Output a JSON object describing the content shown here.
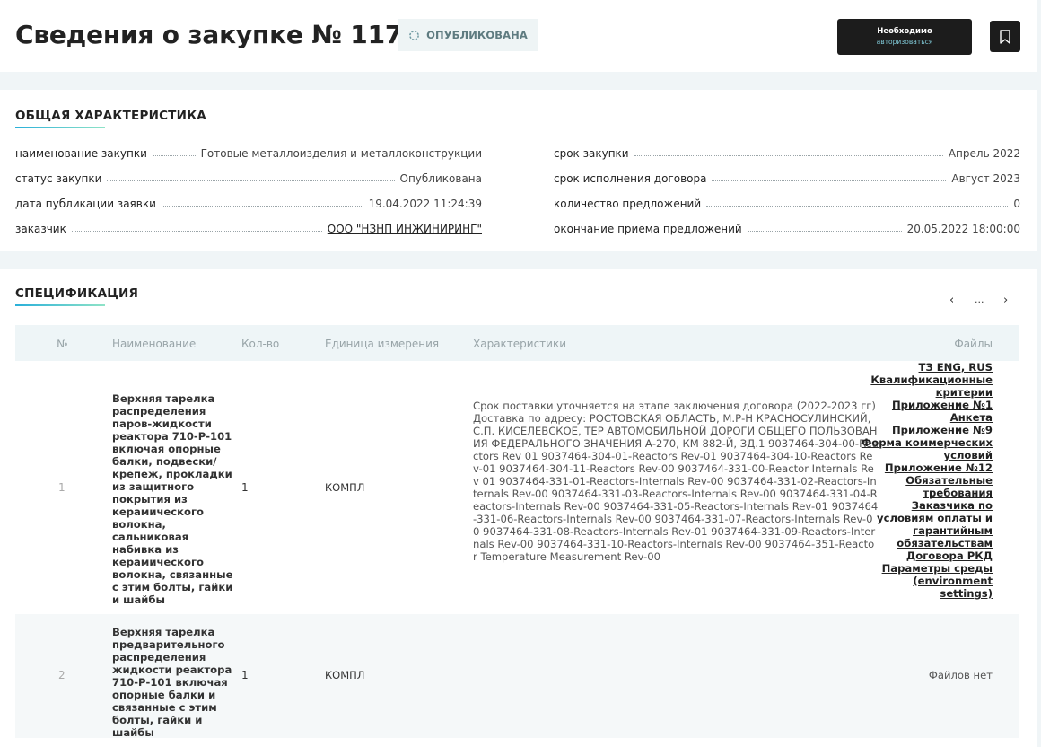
{
  "header": {
    "title": "Сведения о закупке № 11720",
    "status": "ОПУБЛИКОВАНА",
    "auth_line1": "Необходимо",
    "auth_line2": "авторизоваться"
  },
  "general": {
    "title": "ОБЩАЯ ХАРАКТЕРИСТИКА",
    "left": [
      {
        "label": "наименование закупки",
        "value": "Готовые металлоизделия и металлоконструкции"
      },
      {
        "label": "статус закупки",
        "value": "Опубликована"
      },
      {
        "label": "дата публикации заявки",
        "value": "19.04.2022 11:24:39"
      },
      {
        "label": "заказчик",
        "value": "ООО \"НЗНП ИНЖИНИРИНГ\""
      }
    ],
    "right": [
      {
        "label": "срок закупки",
        "value": "Апрель 2022"
      },
      {
        "label": "срок исполнения договора",
        "value": "Август 2023"
      },
      {
        "label": "количество предложений",
        "value": "0"
      },
      {
        "label": "окончание приема предложений",
        "value": "20.05.2022 18:00:00"
      }
    ]
  },
  "spec": {
    "title": "СПЕЦИФИКАЦИЯ",
    "pager": {
      "prev": "‹",
      "ellipsis": "...",
      "next": "›"
    },
    "columns": {
      "num": "№",
      "name": "Наименование",
      "qty": "Кол-во",
      "unit": "Единица измерения",
      "chars": "Характеристики",
      "files": "Файлы"
    },
    "rows": [
      {
        "num": "1",
        "name": "Верхняя тарелка распределения паров-жидкости реактора 710-Р-101 включая опорные балки, подвески/крепеж, прокладки из защитного покрытия из керамического волокна, сальниковая набивка из керамического волокна, связанные с этим болты, гайки и шайбы",
        "qty": "1",
        "unit": "КОМПЛ",
        "chars": "Срок поставки уточняется на этапе заключения договора (2022-2023 гг) Доставка по адресу: РОСТОВСКАЯ ОБЛАСТЬ, М.Р-Н КРАСНОСУЛИНСКИЙ, С.П. КИСЕЛЕВСКОЕ, ТЕР АВТОМОБИЛЬНОЙ ДОРОГИ ОБЩЕГО ПОЛЬЗОВАНИЯ ФЕДЕРАЛЬНОГО ЗНАЧЕНИЯ А-270, КМ 882-Й, ЗД.1 9037464-304-00-Reactors Rev 01 9037464-304-01-Reactors Rev-01 9037464-304-10-Reactors Rev-01 9037464-304-11-Reactors Rev-00 9037464-331-00-Reactor Internals Rev 01 9037464-331-01-Reactors-Internals Rev-00 9037464-331-02-Reactors-Internals Rev-00 9037464-331-03-Reactors-Internals Rev-00 9037464-331-04-Reactors-Internals Rev-00 9037464-331-05-Reactors-Internals Rev-01 9037464-331-06-Reactors-Internals Rev-00 9037464-331-07-Reactors-Internals Rev-00 9037464-331-08-Reactors-Internals Rev-01 9037464-331-09-Reactors-Internals Rev-00 9037464-331-10-Reactors-Internals Rev-00 9037464-351-Reactor Temperature Measurement Rev-00",
        "files": [
          "ТЗ ENG, RUS",
          "Квалификационные критерии",
          "Приложение №1 Анкета",
          "Приложение №9 Форма коммерческих условий",
          "Приложение №12 Обязательные требования Заказчика по условиям оплаты и гарантийным обязательствам",
          "Договора РКД",
          "Параметры среды (environment settings)"
        ]
      },
      {
        "num": "2",
        "name": "Верхняя тарелка предварительного распределения жидкости реактора 710-Р-101 включая опорные балки и связанные с этим болты, гайки и шайбы",
        "qty": "1",
        "unit": "КОМПЛ",
        "no_files": "Файлов нет"
      }
    ]
  }
}
